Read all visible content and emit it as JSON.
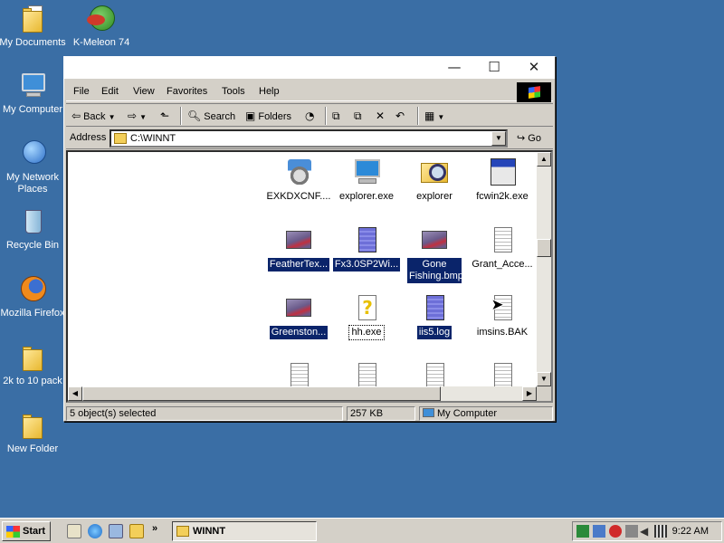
{
  "desktop": {
    "icons": [
      {
        "label": "My Documents"
      },
      {
        "label": "K-Meleon 74"
      },
      {
        "label": "My Computer"
      },
      {
        "label": "My Network Places"
      },
      {
        "label": "Recycle Bin"
      },
      {
        "label": "Mozilla Firefox"
      },
      {
        "label": "2k to 10 pack"
      },
      {
        "label": "New Folder"
      }
    ]
  },
  "window": {
    "controls": {
      "minimize": "—",
      "maximize": "☐",
      "close": "✕"
    },
    "menu": [
      "File",
      "Edit",
      "View",
      "Favorites",
      "Tools",
      "Help"
    ],
    "toolbar": {
      "back": "Back",
      "search": "Search",
      "folders": "Folders"
    },
    "address": {
      "label": "Address",
      "value": "C:\\WINNT",
      "go": "Go"
    },
    "files": [
      {
        "name": "EXKDXCNF....",
        "icon": "gears-icon",
        "selected": false
      },
      {
        "name": "explorer.exe",
        "icon": "computer-exe-icon",
        "selected": false
      },
      {
        "name": "explorer",
        "icon": "folder-search-icon",
        "selected": false
      },
      {
        "name": "fcwin2k.exe",
        "icon": "program-window-icon",
        "selected": false
      },
      {
        "name": "FeatherTex...",
        "icon": "bitmap-icon",
        "selected": true
      },
      {
        "name": "Fx3.0SP2Wi...",
        "icon": "document-icon",
        "selected": true
      },
      {
        "name": "Gone Fishing.bmp",
        "icon": "bitmap-icon",
        "selected": true
      },
      {
        "name": "Grant_Acce...",
        "icon": "text-file-icon",
        "selected": false
      },
      {
        "name": "Greenston...",
        "icon": "bitmap-icon",
        "selected": true
      },
      {
        "name": "hh.exe",
        "icon": "help-icon",
        "selected": false
      },
      {
        "name": "iis5.log",
        "icon": "document-icon",
        "selected": true
      },
      {
        "name": "imsins.BAK",
        "icon": "text-file-icon",
        "selected": false
      }
    ],
    "status": {
      "selection": "5 object(s) selected",
      "size": "257 KB",
      "zone": "My Computer"
    }
  },
  "taskbar": {
    "start": "Start",
    "quicklaunch_more": "»",
    "task": "WINNT",
    "clock": "9:22 AM"
  }
}
